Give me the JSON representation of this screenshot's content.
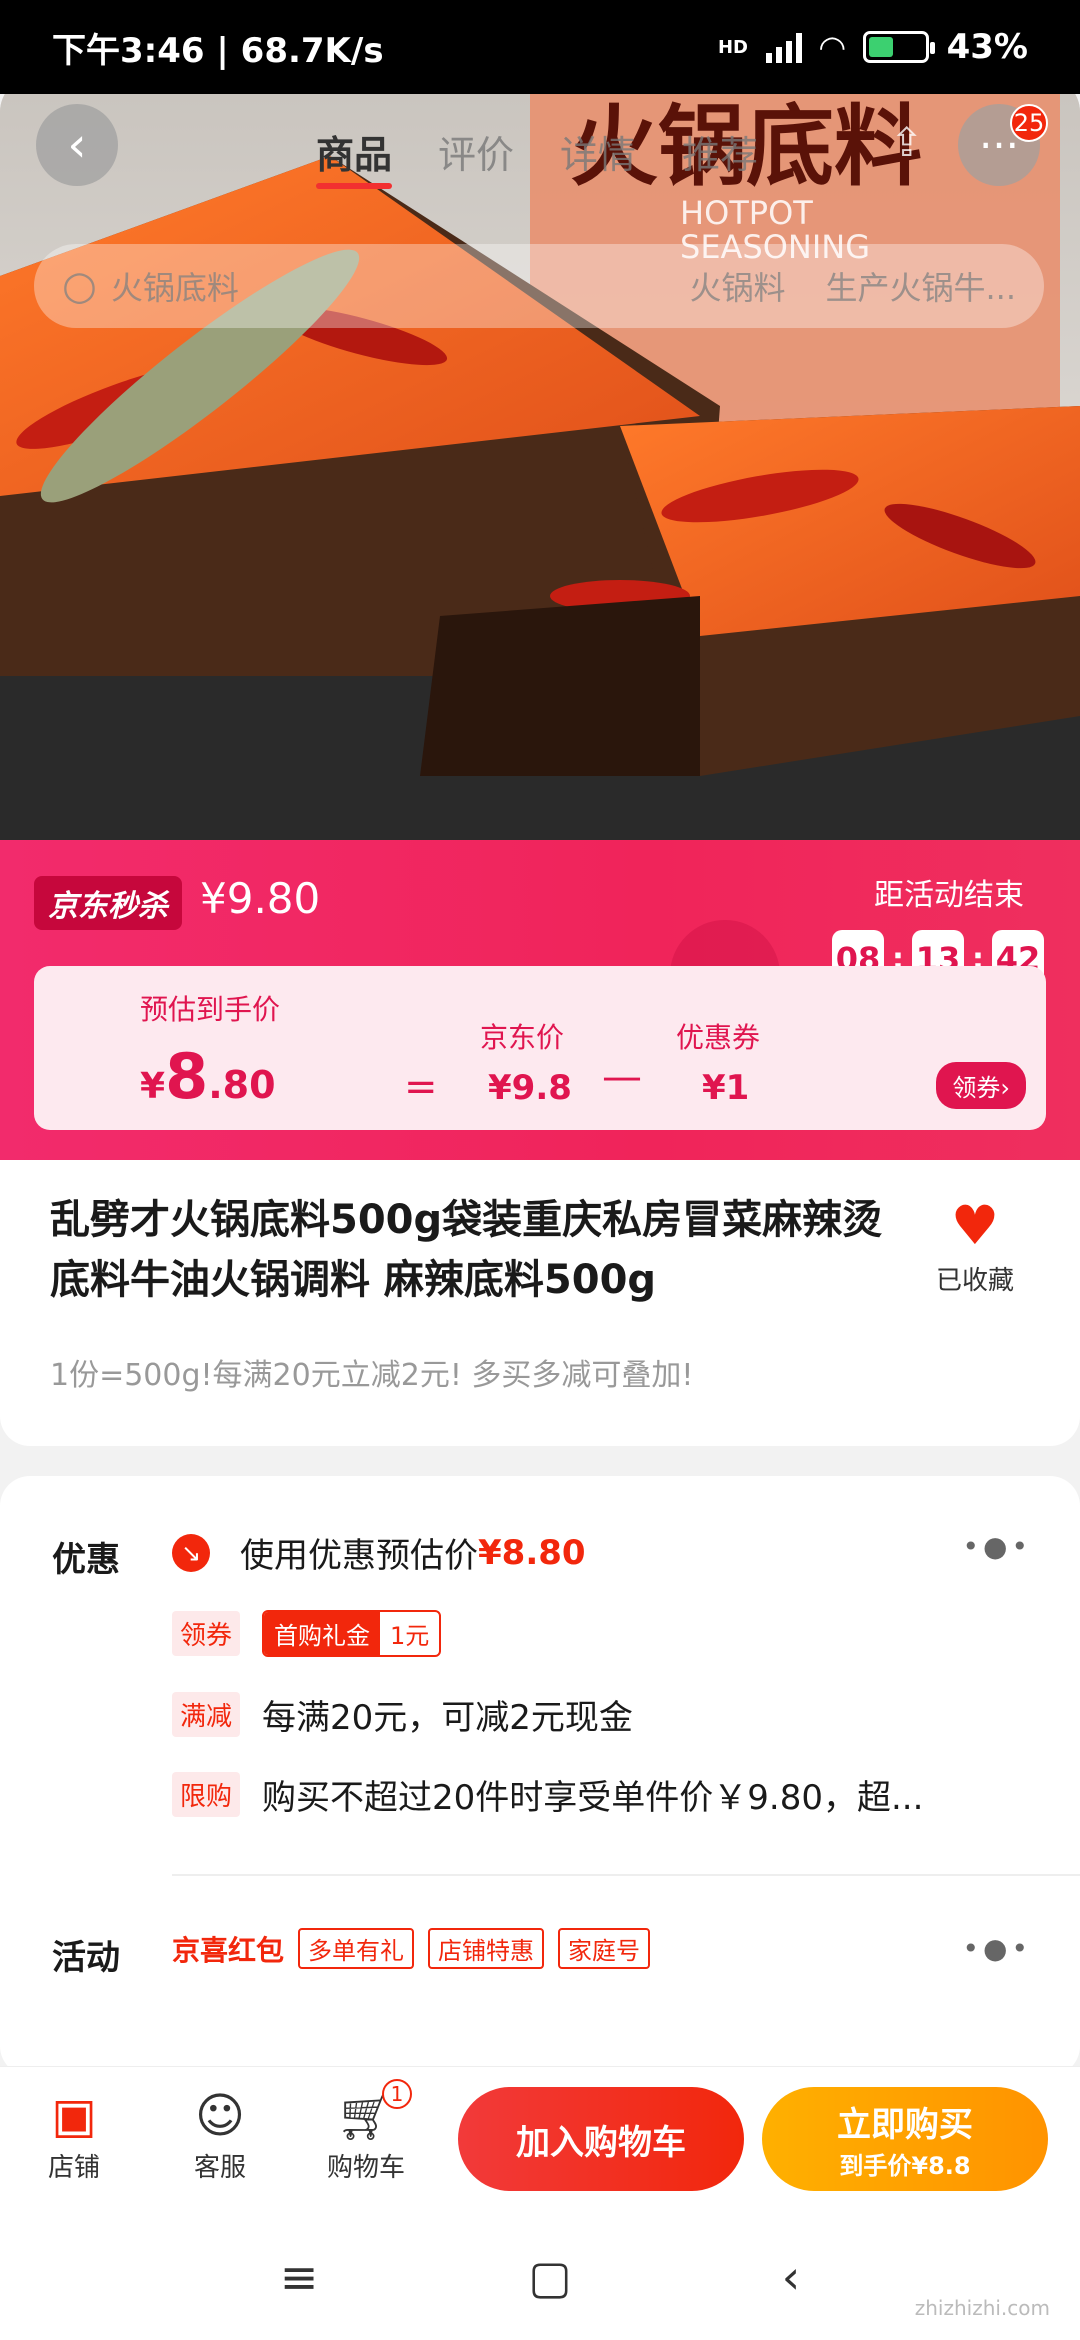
{
  "status_bar": {
    "time": "下午3:46",
    "speed": "68.7K/s",
    "network": "HD",
    "battery": "43%"
  },
  "nav": {
    "tabs": [
      "商品",
      "评价",
      "详情",
      "推荐"
    ],
    "badge": "25",
    "back_icon": "back-arrow-icon",
    "more_icon": "more-icon"
  },
  "search": {
    "placeholder": "火锅底料",
    "tags": [
      "火锅料",
      "生产火锅牛..."
    ]
  },
  "hero": {
    "pack_title": "火锅底料",
    "pack_en": "HOTPOT",
    "pack_en2": "SEASONING"
  },
  "price": {
    "seckill_label": "京东秒杀",
    "original_price": "¥9.80",
    "countdown_label": "距活动结束",
    "countdown": [
      "08",
      "13",
      "42"
    ],
    "est_label": "预估到手价",
    "est_yen": "¥",
    "est_int": "8",
    "est_dec": ".80",
    "eq": "=",
    "jd_label": "京东价",
    "jd_value": "¥9.8",
    "minus": "—",
    "coupon_label": "优惠券",
    "coupon_value": "¥1",
    "get_coupon": "领券›"
  },
  "product": {
    "title": "乱劈才火锅底料500g袋装重庆私房冒菜麻辣烫底料牛油火锅调料 麻辣底料500g",
    "fav_label": "已收藏",
    "desc": "1份=500g!每满20元立减2元! 多买多减可叠加!"
  },
  "promo": {
    "section_label": "优惠",
    "use_text": "使用优惠预估价",
    "use_price": "¥8.80",
    "coupon_tag": "领券",
    "coupon_a": "首购礼金",
    "coupon_b": "1元",
    "mj_tag": "满减",
    "mj_text": "每满20元，可减2元现金",
    "xg_tag": "限购",
    "xg_text": "购买不超过20件时享受单件价￥9.80，超...",
    "activity_label": "活动",
    "hongbao": "京喜红包",
    "act_tags": [
      "多单有礼",
      "店铺特惠",
      "家庭号"
    ]
  },
  "bottom": {
    "store": "店铺",
    "service": "客服",
    "cart": "购物车",
    "cart_count": "1",
    "add_cart": "加入购物车",
    "buy_now": "立即购买",
    "buy_sub": "到手价¥8.8"
  },
  "watermark": "zhizhizhi.com"
}
